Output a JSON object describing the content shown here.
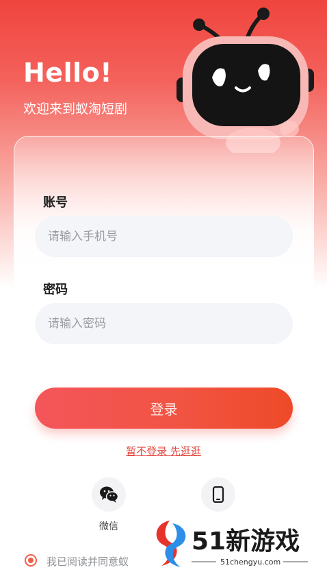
{
  "header": {
    "hello": "Hello!",
    "welcome": "欢迎来到蚁淘短剧"
  },
  "form": {
    "account_label": "账号",
    "account_placeholder": "请输入手机号",
    "password_label": "密码",
    "password_placeholder": "请输入密码"
  },
  "login_button": "登录",
  "guest_link": "暂不登录 先逛逛",
  "social": {
    "wechat_label": "微信",
    "wechat_icon": "wechat-icon",
    "phone_icon": "phone-icon"
  },
  "agreement": {
    "text": "我已阅读并同意蚁"
  },
  "watermark": {
    "title": "51新游戏",
    "url": "51chengyu.com"
  },
  "colors": {
    "brand_red": "#f0443e",
    "button_red": "#f15443",
    "link_red": "#e2473f"
  }
}
